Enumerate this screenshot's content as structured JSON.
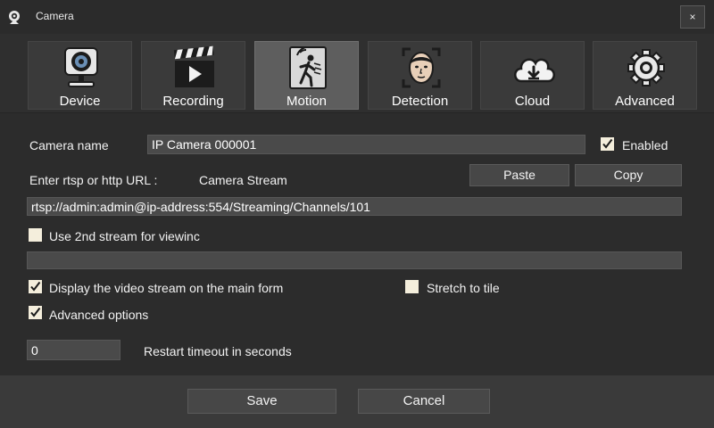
{
  "window": {
    "title": "Camera",
    "close_label": "×"
  },
  "tabs": [
    {
      "label": "Device",
      "icon": "webcam-icon",
      "active": false
    },
    {
      "label": "Recording",
      "icon": "clapperboard-icon",
      "active": false
    },
    {
      "label": "Motion",
      "icon": "motion-sensor-icon",
      "active": true
    },
    {
      "label": "Detection",
      "icon": "face-detection-icon",
      "active": false
    },
    {
      "label": "Cloud",
      "icon": "cloud-download-icon",
      "active": false
    },
    {
      "label": "Advanced",
      "icon": "gear-icon",
      "active": false
    }
  ],
  "form": {
    "camera_name_label": "Camera name",
    "camera_name_value": "IP Camera 000001",
    "enabled_label": "Enabled",
    "enabled_checked": true,
    "url_label": "Enter rtsp or http URL :",
    "stream_label": "Camera Stream",
    "paste_label": "Paste",
    "copy_label": "Copy",
    "url_value": "rtsp://admin:admin@ip-address:554/Streaming/Channels/101",
    "second_stream_label": "Use 2nd stream for viewinc",
    "second_stream_checked": false,
    "second_stream_value": "",
    "display_label": "Display the video stream on the main form",
    "display_checked": true,
    "stretch_label": "Stretch to tile",
    "stretch_checked": false,
    "advanced_label": "Advanced options",
    "advanced_checked": true,
    "restart_value": "0",
    "restart_label": "Restart timeout in seconds"
  },
  "footer": {
    "save_label": "Save",
    "cancel_label": "Cancel"
  },
  "colors": {
    "background": "#2d2d2d",
    "active_tab": "#5e5e5e",
    "field": "#4a4a4a",
    "checkbox": "#f4eedc"
  }
}
